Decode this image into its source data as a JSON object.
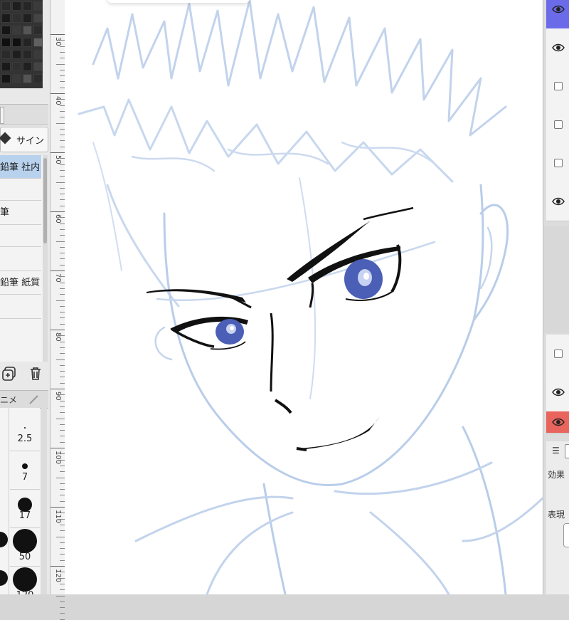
{
  "left_panel": {
    "tool_name": "サイン",
    "brushes": [
      {
        "label": "鉛筆 社内",
        "selected": true
      },
      {
        "label": "",
        "selected": false
      },
      {
        "label": "筆",
        "selected": false
      },
      {
        "label": "",
        "selected": false
      },
      {
        "label": "",
        "selected": false
      },
      {
        "label": "鉛筆 紙質",
        "selected": false
      },
      {
        "label": "",
        "selected": false
      }
    ],
    "tab2_label": "ニメ",
    "brush_sizes": [
      "2.5",
      "7",
      "17",
      "50",
      "120"
    ],
    "icons": [
      "duplicate-icon",
      "trash-icon",
      "eraser-icon",
      "pen-icon"
    ]
  },
  "ruler": {
    "ticks": [
      "30",
      "40",
      "50",
      "60",
      "70",
      "80",
      "90",
      "100",
      "110",
      "120"
    ]
  },
  "right_panel": {
    "layers": [
      {
        "visible": true,
        "color": "#6b6bea"
      },
      {
        "visible": true,
        "color": ""
      },
      {
        "visible": false,
        "color": ""
      },
      {
        "visible": false,
        "color": ""
      },
      {
        "visible": false,
        "color": ""
      },
      {
        "visible": true,
        "color": ""
      }
    ],
    "lower_layers": [
      {
        "visible": false,
        "color": ""
      },
      {
        "visible": true,
        "color": ""
      },
      {
        "visible": true,
        "color": "#e8645c"
      }
    ],
    "properties": {
      "menu": "☰",
      "effect_label": "効果",
      "expression_label": "表現"
    }
  },
  "colors": {
    "eye_blue": "#4a5fb5",
    "sketch_blue": "#b9cde9",
    "ink": "#111111",
    "selection": "#b8d2ee"
  }
}
